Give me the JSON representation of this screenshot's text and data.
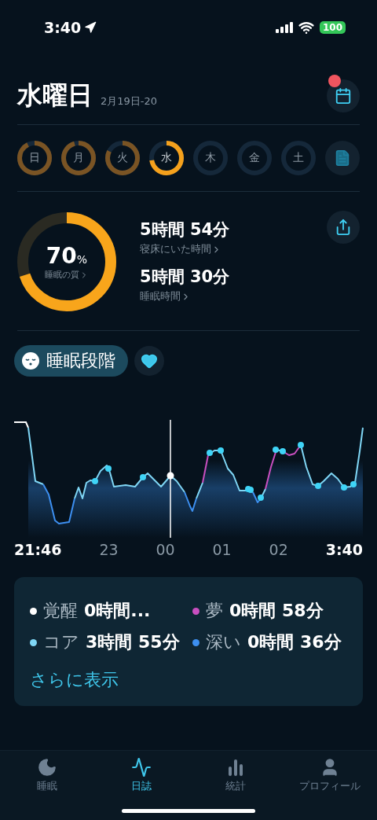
{
  "status_bar": {
    "time": "3:40",
    "battery": "100"
  },
  "header": {
    "title": "水曜日",
    "date_range": "2月19日-20",
    "calendar_badge": true
  },
  "days": [
    {
      "label": "日",
      "level": 0.92,
      "selected": false
    },
    {
      "label": "月",
      "level": 0.95,
      "selected": false
    },
    {
      "label": "火",
      "level": 0.82,
      "selected": false
    },
    {
      "label": "水",
      "level": 0.72,
      "selected": true
    },
    {
      "label": "木",
      "selected": false
    },
    {
      "label": "金",
      "selected": false
    },
    {
      "label": "土",
      "selected": false
    }
  ],
  "summary": {
    "quality": {
      "value": "70",
      "unit": "%",
      "label": "睡眠の質",
      "level": 0.7
    },
    "stats": [
      {
        "value": "5時間 54分",
        "label": "寝床にいた時間"
      },
      {
        "value": "5時間 30分",
        "label": "睡眠時間"
      }
    ]
  },
  "section": {
    "title": "睡眠段階",
    "favorite": true
  },
  "chart": {
    "start": "21:46",
    "ticks": [
      "23",
      "00",
      "01",
      "02"
    ],
    "end": "3:40"
  },
  "legend": [
    {
      "label": "覚醒",
      "value": "0時間...",
      "color": "#ffffff"
    },
    {
      "label": "夢",
      "value": "0時間 58分",
      "color": "#c94fc0"
    },
    {
      "label": "コア",
      "value": "3時間 55分",
      "color": "#7fd6f5"
    },
    {
      "label": "深い",
      "value": "0時間 36分",
      "color": "#3d8ff0"
    }
  ],
  "more_link": "さらに表示",
  "tabs": [
    {
      "label": "睡眠",
      "kind": "moon",
      "selected": false
    },
    {
      "label": "日誌",
      "kind": "journal",
      "selected": true
    },
    {
      "label": "統計",
      "kind": "stats",
      "selected": false
    },
    {
      "label": "プロフィール",
      "kind": "profile",
      "selected": false
    }
  ]
}
